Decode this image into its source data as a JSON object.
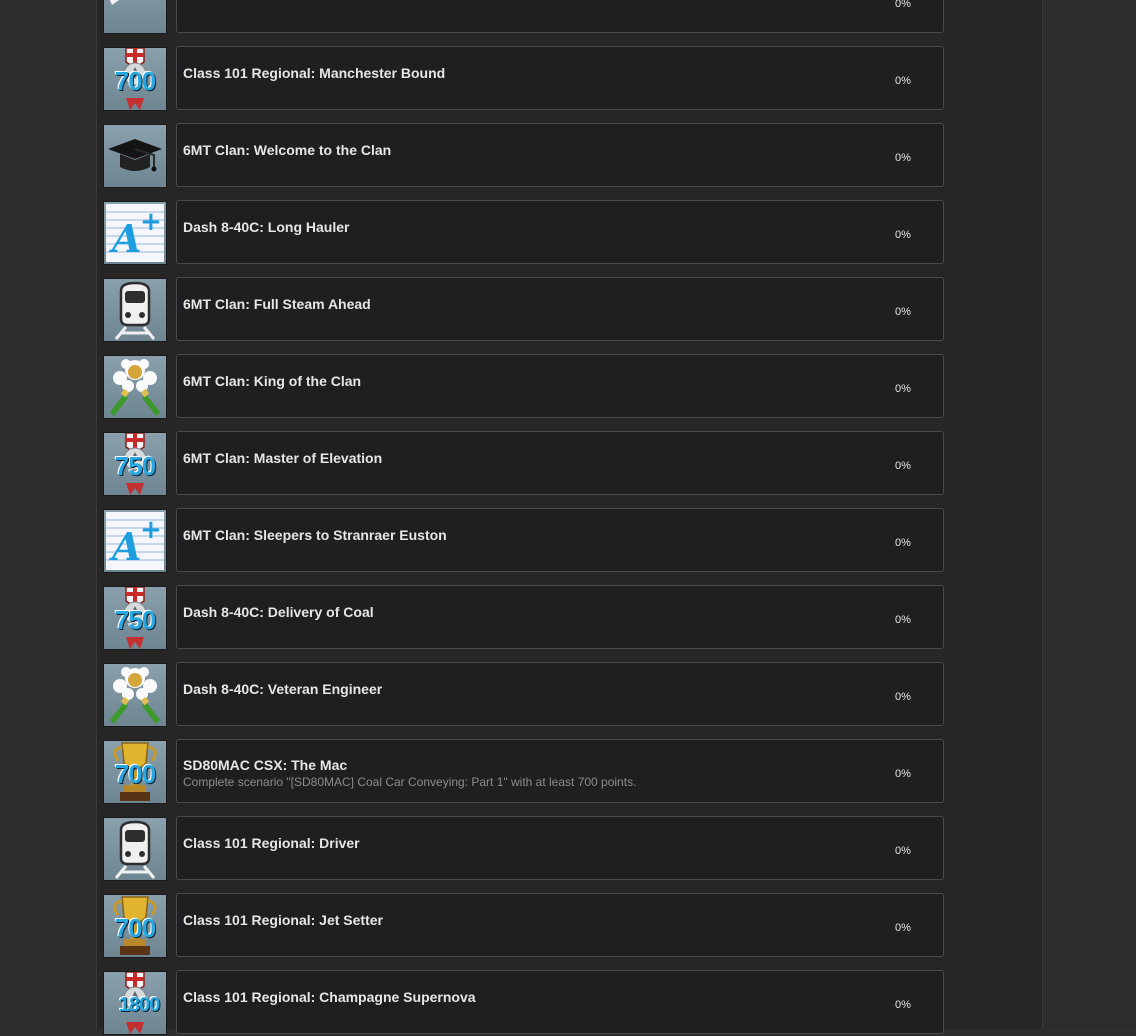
{
  "achievements": [
    {
      "title": "",
      "description": "",
      "progress": "0%",
      "icon": "ribbon-medal-icon",
      "badge_number": ""
    },
    {
      "title": "Class 101 Regional: Manchester Bound",
      "description": "",
      "progress": "0%",
      "icon": "medal-score-icon",
      "badge_number": "700"
    },
    {
      "title": "6MT Clan: Welcome to the Clan",
      "description": "",
      "progress": "0%",
      "icon": "graduation-cap-icon",
      "badge_number": ""
    },
    {
      "title": "Dash 8-40C: Long Hauler",
      "description": "",
      "progress": "0%",
      "icon": "a-plus-grade-icon",
      "badge_number": ""
    },
    {
      "title": "6MT Clan: Full Steam Ahead",
      "description": "",
      "progress": "0%",
      "icon": "train-icon",
      "badge_number": ""
    },
    {
      "title": "6MT Clan: King of the Clan",
      "description": "",
      "progress": "0%",
      "icon": "champagne-icon",
      "badge_number": ""
    },
    {
      "title": "6MT Clan: Master of Elevation",
      "description": "",
      "progress": "0%",
      "icon": "medal-score-icon",
      "badge_number": "750"
    },
    {
      "title": "6MT Clan: Sleepers to Stranraer Euston",
      "description": "",
      "progress": "0%",
      "icon": "a-plus-grade-icon",
      "badge_number": ""
    },
    {
      "title": "Dash 8-40C: Delivery of Coal",
      "description": "",
      "progress": "0%",
      "icon": "medal-score-icon",
      "badge_number": "750"
    },
    {
      "title": "Dash 8-40C: Veteran Engineer",
      "description": "",
      "progress": "0%",
      "icon": "champagne-icon",
      "badge_number": ""
    },
    {
      "title": "SD80MAC CSX: The Mac",
      "description": "Complete scenario \"[SD80MAC] Coal Car Conveying: Part 1\" with at least 700 points.",
      "progress": "0%",
      "icon": "trophy-score-icon",
      "badge_number": "700"
    },
    {
      "title": "Class 101 Regional: Driver",
      "description": "",
      "progress": "0%",
      "icon": "train-icon",
      "badge_number": ""
    },
    {
      "title": "Class 101 Regional: Jet Setter",
      "description": "",
      "progress": "0%",
      "icon": "trophy-score-icon",
      "badge_number": "700"
    },
    {
      "title": "Class 101 Regional: Champagne Supernova",
      "description": "",
      "progress": "0%",
      "icon": "medal-score-icon",
      "badge_number": "1800"
    }
  ]
}
